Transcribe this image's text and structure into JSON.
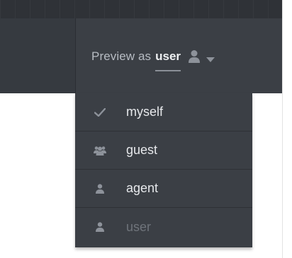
{
  "preview": {
    "prefix": "Preview as",
    "role": "user",
    "avatar_icon": "user-silhouette-icon",
    "caret_icon": "chevron-down-icon"
  },
  "menu": {
    "items": [
      {
        "label": "myself",
        "icon": "check-icon",
        "selected": true,
        "disabled": false
      },
      {
        "label": "guest",
        "icon": "users-group-icon",
        "selected": false,
        "disabled": false
      },
      {
        "label": "agent",
        "icon": "user-icon",
        "selected": false,
        "disabled": false
      },
      {
        "label": "user",
        "icon": "user-icon",
        "selected": false,
        "disabled": true
      }
    ]
  },
  "colors": {
    "bar": "#363a40",
    "panel": "#3b3f45",
    "text_light": "#e6e8eb",
    "text_muted": "#6f747b",
    "icon": "#8d929a"
  }
}
